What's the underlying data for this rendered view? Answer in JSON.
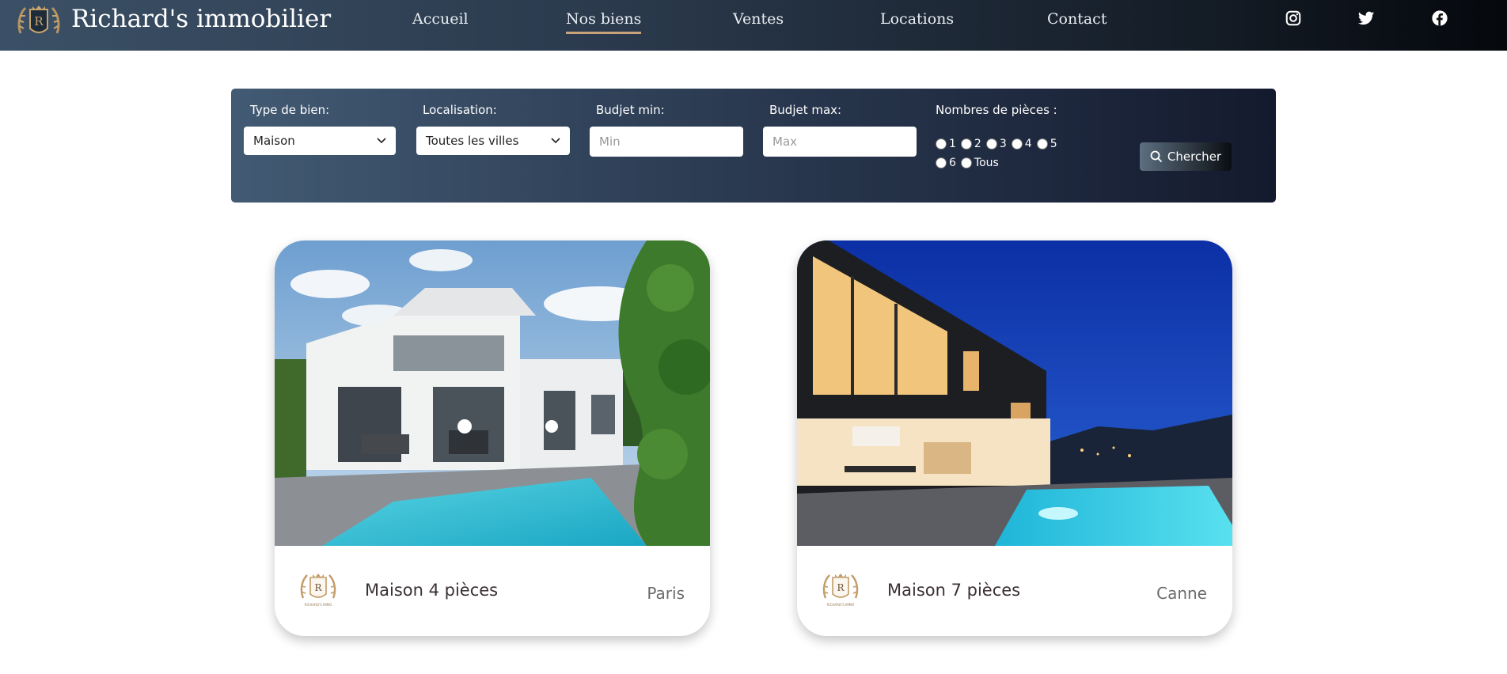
{
  "brand": {
    "name": "Richard's immobilier",
    "logo_letter": "R",
    "logo_caption": "RICHARD'S IMMO"
  },
  "nav": [
    {
      "label": "Accueil",
      "active": false
    },
    {
      "label": "Nos biens",
      "active": true
    },
    {
      "label": "Ventes",
      "active": false
    },
    {
      "label": "Locations",
      "active": false
    },
    {
      "label": "Contact",
      "active": false
    }
  ],
  "social": [
    "instagram-icon",
    "twitter-icon",
    "facebook-icon"
  ],
  "search": {
    "type_label": "Type de bien:",
    "type_value": "Maison",
    "location_label": "Localisation:",
    "location_value": "Toutes les villes",
    "budget_min_label": "Budjet min:",
    "budget_min_placeholder": "Min",
    "budget_max_label": "Budjet max:",
    "budget_max_placeholder": "Max",
    "rooms_label": "Nombres de pièces :",
    "rooms": [
      "1",
      "2",
      "3",
      "4",
      "5",
      "6",
      "Tous"
    ],
    "submit_label": "Chercher"
  },
  "listings": [
    {
      "title": "Maison 4 pièces",
      "city": "Paris"
    },
    {
      "title": "Maison 7 pièces",
      "city": "Canne"
    }
  ],
  "colors": {
    "accent_underline": "#c9a37a",
    "panel": "#2e3f56",
    "header": "#2b3a4d"
  }
}
